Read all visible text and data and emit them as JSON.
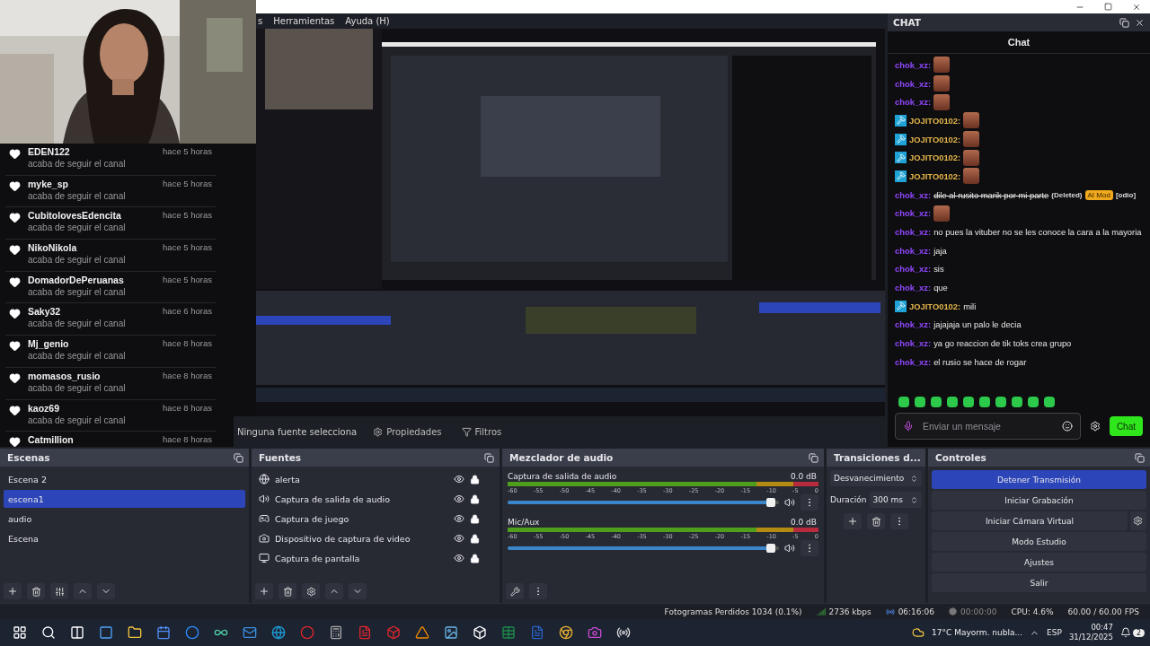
{
  "window": {
    "menu": [
      "s",
      "Herramientas",
      "Ayuda (H)"
    ]
  },
  "followers": [
    {
      "name": "EDEN122",
      "action": "acaba de seguir el canal",
      "time": "hace 5 horas"
    },
    {
      "name": "myke_sp",
      "action": "acaba de seguir el canal",
      "time": "hace 5 horas"
    },
    {
      "name": "CubitolovesEdencita",
      "action": "acaba de seguir el canal",
      "time": "hace 5 horas"
    },
    {
      "name": "NikoNikola",
      "action": "acaba de seguir el canal",
      "time": "hace 5 horas"
    },
    {
      "name": "DomadorDePeruanas",
      "action": "acaba de seguir el canal",
      "time": "hace 5 horas"
    },
    {
      "name": "Saky32",
      "action": "acaba de seguir el canal",
      "time": "hace 6 horas"
    },
    {
      "name": "Mj_genio",
      "action": "acaba de seguir el canal",
      "time": "hace 8 horas"
    },
    {
      "name": "momasos_rusio",
      "action": "acaba de seguir el canal",
      "time": "hace 8 horas"
    },
    {
      "name": "kaoz69",
      "action": "acaba de seguir el canal",
      "time": "hace 8 horas"
    },
    {
      "name": "Catmillion",
      "time": "hace 8 horas"
    }
  ],
  "preview": {
    "source_bar": {
      "label": "Ninguna fuente selecciona",
      "buttons": [
        "Propiedades",
        "Filtros"
      ]
    }
  },
  "chat": {
    "dock_title": "CHAT",
    "title": "Chat",
    "messages": [
      {
        "user": "chok_xz:",
        "mod": false,
        "kind": "emote"
      },
      {
        "user": "chok_xz:",
        "mod": false,
        "kind": "emote"
      },
      {
        "user": "chok_xz:",
        "mod": false,
        "kind": "emote"
      },
      {
        "user": "JOJITO0102:",
        "mod": true,
        "kind": "emote"
      },
      {
        "user": "JOJITO0102:",
        "mod": true,
        "kind": "emote"
      },
      {
        "user": "JOJITO0102:",
        "mod": true,
        "kind": "emote"
      },
      {
        "user": "JOJITO0102:",
        "mod": true,
        "kind": "emote"
      },
      {
        "user": "chok_xz:",
        "mod": false,
        "kind": "deleted",
        "text": "dile al rusito marik por mi parte",
        "note": "(Deleted)",
        "tag": "AI Mod",
        "reason": "[odio]"
      },
      {
        "user": "chok_xz:",
        "mod": false,
        "kind": "emote"
      },
      {
        "user": "chok_xz:",
        "mod": false,
        "kind": "text",
        "text": "no pues la vituber no se les conoce la cara a la mayoria"
      },
      {
        "user": "chok_xz:",
        "mod": false,
        "kind": "text",
        "text": "jaja"
      },
      {
        "user": "chok_xz:",
        "mod": false,
        "kind": "text",
        "text": "sis"
      },
      {
        "user": "chok_xz:",
        "mod": false,
        "kind": "text",
        "text": "que"
      },
      {
        "user": "JOJITO0102:",
        "mod": true,
        "kind": "text",
        "text": "mili"
      },
      {
        "user": "chok_xz:",
        "mod": false,
        "kind": "text",
        "text": "jajajaja un palo le decia"
      },
      {
        "user": "chok_xz:",
        "mod": false,
        "kind": "text",
        "text": "ya go reaccion de tik toks crea grupo"
      },
      {
        "user": "chok_xz:",
        "mod": false,
        "kind": "text",
        "text": "el rusio se hace de rogar"
      }
    ],
    "input": {
      "placeholder": "Enviar un mensaje"
    },
    "send": "Chat"
  },
  "scenes": {
    "title": "Escenas",
    "items": [
      {
        "label": "Escena 2",
        "selected": false
      },
      {
        "label": "escena1",
        "selected": true
      },
      {
        "label": "audio",
        "selected": false
      },
      {
        "label": "Escena",
        "selected": false
      }
    ]
  },
  "sources": {
    "title": "Fuentes",
    "items": [
      {
        "label": "alerta",
        "kind": "browser"
      },
      {
        "label": "Captura de salida de audio",
        "kind": "audio"
      },
      {
        "label": "Captura de juego",
        "kind": "game"
      },
      {
        "label": "Dispositivo de captura de video",
        "kind": "camera"
      },
      {
        "label": "Captura de pantalla",
        "kind": "display"
      }
    ]
  },
  "mixer": {
    "title": "Mezclador de audio",
    "channels": [
      {
        "name": "Captura de salida de audio",
        "reading": "0.0 dB",
        "level": 0.97,
        "scale": [
          "-60",
          "-55",
          "-50",
          "-45",
          "-40",
          "-35",
          "-30",
          "-25",
          "-20",
          "-15",
          "-10",
          "-5",
          "0"
        ]
      },
      {
        "name": "Mic/Aux",
        "reading": "0.0 dB",
        "level": 0.97,
        "scale": [
          "-60",
          "-55",
          "-50",
          "-45",
          "-40",
          "-35",
          "-30",
          "-25",
          "-20",
          "-15",
          "-10",
          "-5",
          "0"
        ]
      }
    ]
  },
  "transitions": {
    "title": "Transiciones d...",
    "type": "Desvanecimiento",
    "duration_label": "Duración",
    "duration": "300 ms"
  },
  "controls": {
    "title": "Controles",
    "buttons": [
      {
        "label": "Detener Transmisión",
        "active": true
      },
      {
        "label": "Iniciar Grabación",
        "active": false
      },
      {
        "label": "Iniciar Cámara Virtual",
        "active": false
      },
      {
        "label": "Modo Estudio",
        "active": false
      },
      {
        "label": "Ajustes",
        "active": false
      },
      {
        "label": "Salir",
        "active": false
      }
    ]
  },
  "status_bar": {
    "dropped": "Fotogramas Perdidos 1034 (0.1%)",
    "bitrate": "2736 kbps",
    "stream_time": "06:16:06",
    "rec_time": "00:00:00",
    "cpu": "CPU: 4.6%",
    "fps": "60.00 / 60.00 FPS"
  },
  "taskbar": {
    "weather": "17°C  Mayorm. nubla...",
    "lang": "ESP",
    "time": "00:47",
    "date": "31/12/2025",
    "notifications": "2"
  }
}
